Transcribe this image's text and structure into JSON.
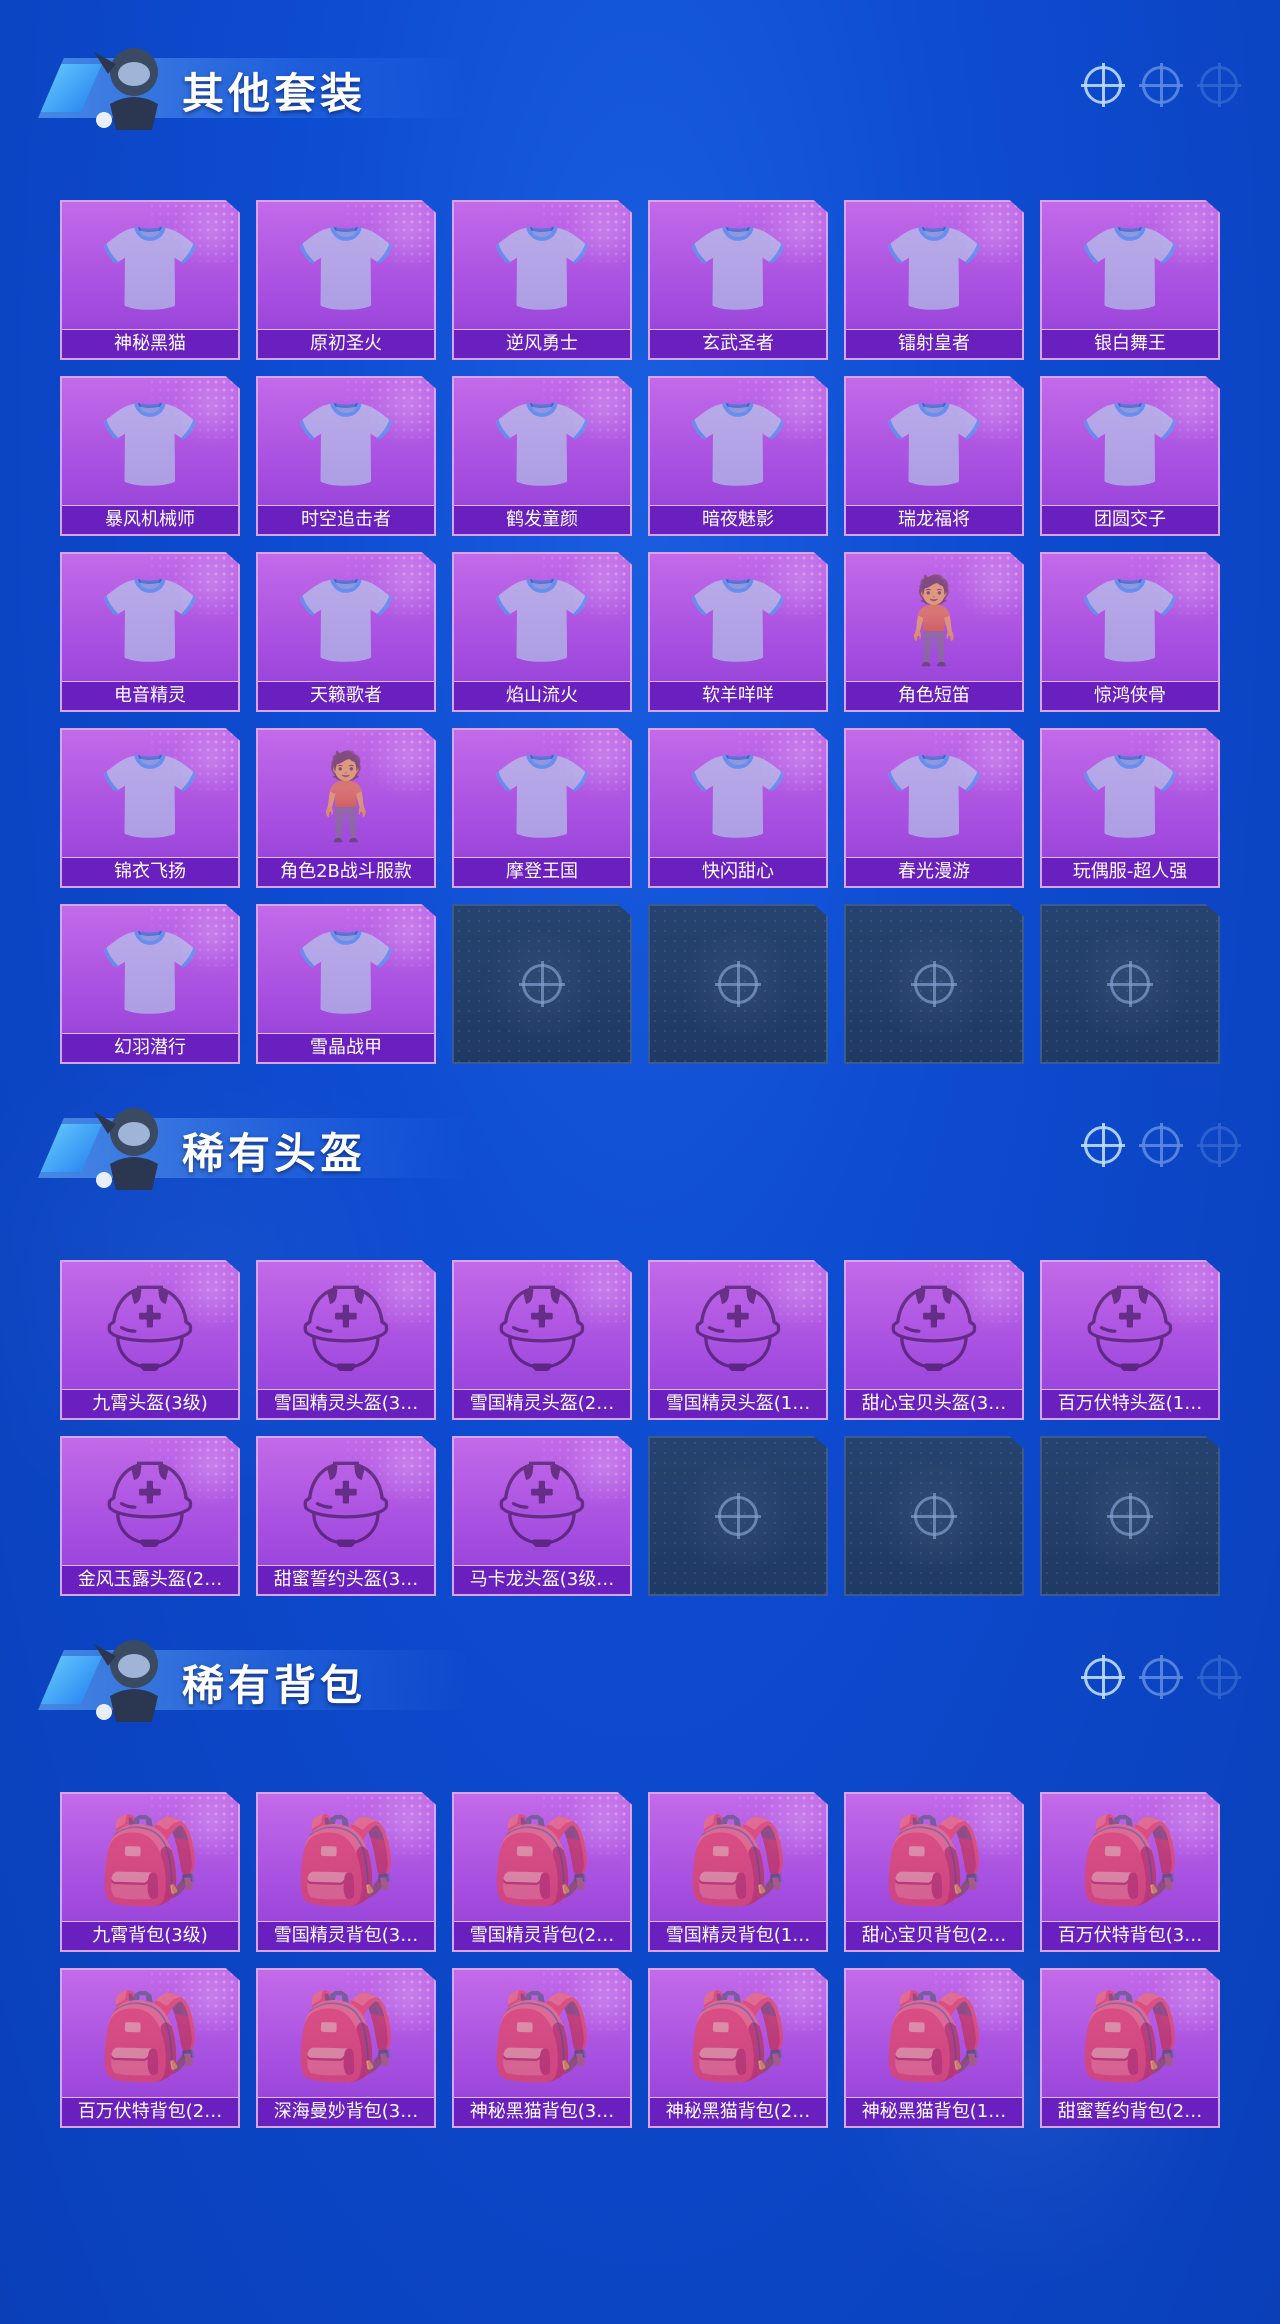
{
  "sections": [
    {
      "title": "其他套装",
      "items": [
        {
          "label": "神秘黑猫",
          "icon": "outfit-icon"
        },
        {
          "label": "原初圣火",
          "icon": "outfit-icon"
        },
        {
          "label": "逆风勇士",
          "icon": "outfit-icon"
        },
        {
          "label": "玄武圣者",
          "icon": "outfit-icon"
        },
        {
          "label": "镭射皇者",
          "icon": "outfit-icon"
        },
        {
          "label": "银白舞王",
          "icon": "outfit-icon"
        },
        {
          "label": "暴风机械师",
          "icon": "outfit-icon"
        },
        {
          "label": "时空追击者",
          "icon": "outfit-icon"
        },
        {
          "label": "鹤发童颜",
          "icon": "outfit-icon"
        },
        {
          "label": "暗夜魅影",
          "icon": "outfit-icon"
        },
        {
          "label": "瑞龙福将",
          "icon": "outfit-icon"
        },
        {
          "label": "团圆交子",
          "icon": "outfit-icon"
        },
        {
          "label": "电音精灵",
          "icon": "outfit-icon"
        },
        {
          "label": "天籁歌者",
          "icon": "outfit-icon"
        },
        {
          "label": "焰山流火",
          "icon": "outfit-icon"
        },
        {
          "label": "软羊咩咩",
          "icon": "outfit-icon"
        },
        {
          "label": "角色短笛",
          "icon": "character-icon"
        },
        {
          "label": "惊鸿侠骨",
          "icon": "outfit-icon"
        },
        {
          "label": "锦衣飞扬",
          "icon": "outfit-icon"
        },
        {
          "label": "角色2B战斗服款",
          "icon": "character-icon"
        },
        {
          "label": "摩登王国",
          "icon": "outfit-icon"
        },
        {
          "label": "快闪甜心",
          "icon": "outfit-icon"
        },
        {
          "label": "春光漫游",
          "icon": "outfit-icon"
        },
        {
          "label": "玩偶服-超人强",
          "icon": "outfit-icon"
        },
        {
          "label": "幻羽潜行",
          "icon": "outfit-icon"
        },
        {
          "label": "雪晶战甲",
          "icon": "outfit-icon"
        }
      ],
      "empty": 4
    },
    {
      "title": "稀有头盔",
      "items": [
        {
          "label": "九霄头盔(3级)",
          "icon": "helmet-icon"
        },
        {
          "label": "雪国精灵头盔(3…",
          "icon": "helmet-icon"
        },
        {
          "label": "雪国精灵头盔(2…",
          "icon": "helmet-icon"
        },
        {
          "label": "雪国精灵头盔(1…",
          "icon": "helmet-icon"
        },
        {
          "label": "甜心宝贝头盔(3…",
          "icon": "helmet-icon"
        },
        {
          "label": "百万伏特头盔(1…",
          "icon": "helmet-icon"
        },
        {
          "label": "金风玉露头盔(2…",
          "icon": "helmet-icon"
        },
        {
          "label": "甜蜜誓约头盔(3…",
          "icon": "helmet-icon"
        },
        {
          "label": "马卡龙头盔(3级…",
          "icon": "helmet-icon"
        }
      ],
      "empty": 3
    },
    {
      "title": "稀有背包",
      "items": [
        {
          "label": "九霄背包(3级)",
          "icon": "backpack-icon"
        },
        {
          "label": "雪国精灵背包(3…",
          "icon": "backpack-icon"
        },
        {
          "label": "雪国精灵背包(2…",
          "icon": "backpack-icon"
        },
        {
          "label": "雪国精灵背包(1…",
          "icon": "backpack-icon"
        },
        {
          "label": "甜心宝贝背包(2…",
          "icon": "backpack-icon"
        },
        {
          "label": "百万伏特背包(3…",
          "icon": "backpack-icon"
        },
        {
          "label": "百万伏特背包(2…",
          "icon": "backpack-icon"
        },
        {
          "label": "深海曼妙背包(3…",
          "icon": "backpack-icon"
        },
        {
          "label": "神秘黑猫背包(3…",
          "icon": "backpack-icon"
        },
        {
          "label": "神秘黑猫背包(2…",
          "icon": "backpack-icon"
        },
        {
          "label": "神秘黑猫背包(1…",
          "icon": "backpack-icon"
        },
        {
          "label": "甜蜜誓约背包(2…",
          "icon": "backpack-icon"
        }
      ],
      "empty": 0
    }
  ],
  "colors": {
    "background": "#0d4bd0",
    "card": "#a64ee0",
    "label_bar": "#6a1fbf",
    "empty_card": "#233f6a"
  }
}
